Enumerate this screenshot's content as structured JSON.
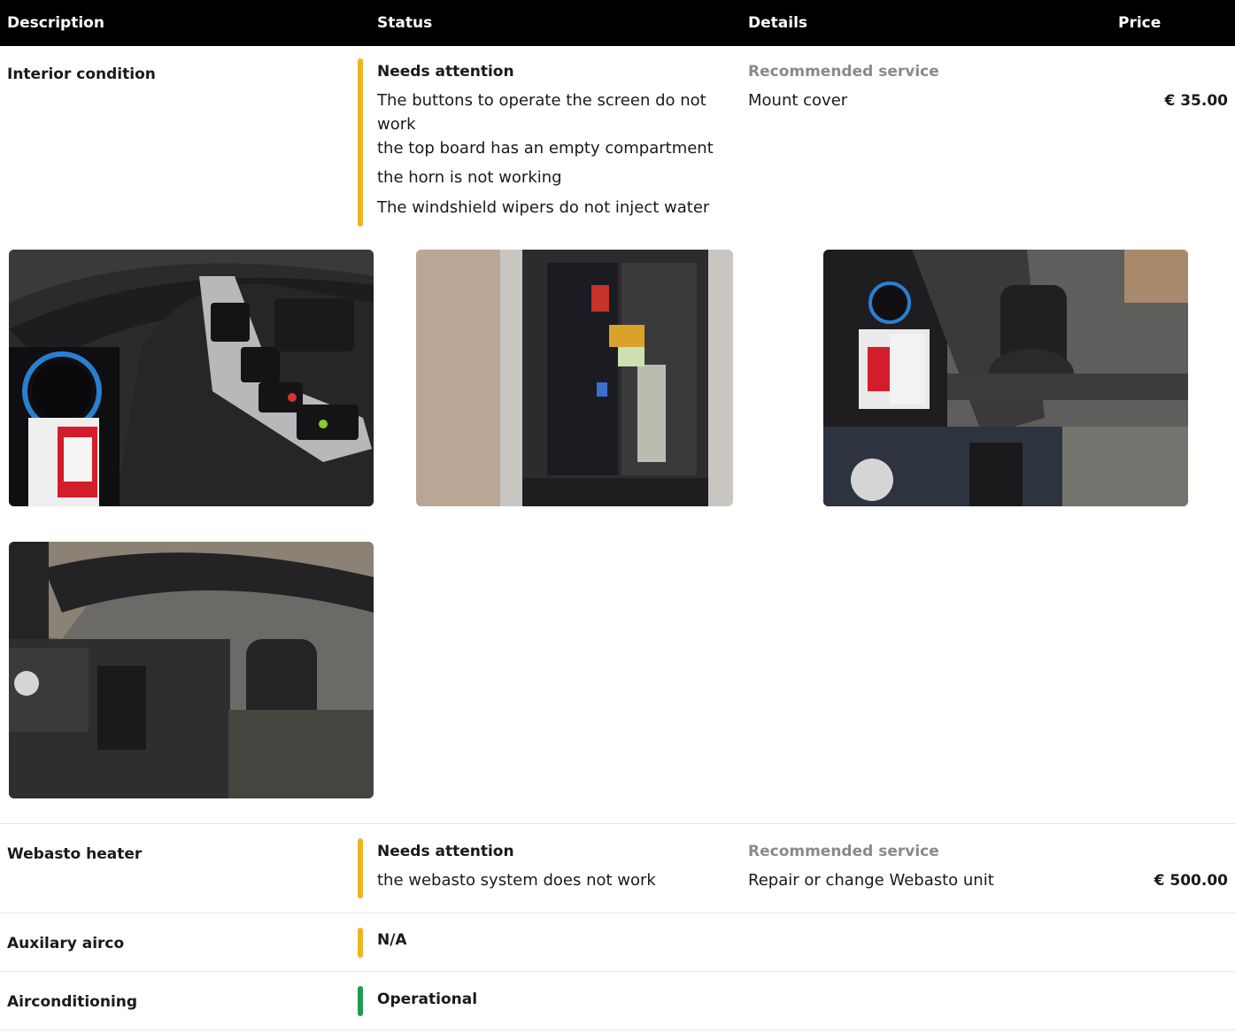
{
  "header": {
    "description": "Description",
    "status": "Status",
    "details": "Details",
    "price": "Price"
  },
  "colors": {
    "attention": "#f0b323",
    "operational": "#1f9a54",
    "header_bg": "#000000"
  },
  "rows": [
    {
      "title": "Interior condition",
      "status": "Needs attention",
      "status_color": "attention",
      "issues": [
        "The buttons to operate the screen do not work",
        "the top board has an empty compartment",
        "the horn is not working",
        "The windshield wipers do not inject water"
      ],
      "service_label": "Recommended service",
      "service": "Mount cover",
      "price": "€ 35.00",
      "photos": [
        "steering-wheel-buttons-photo",
        "radio-compartment-tachograph-photo",
        "dashboard-stalk-photo",
        "wiper-stalk-photo"
      ]
    },
    {
      "title": "Webasto heater",
      "status": "Needs attention",
      "status_color": "attention",
      "issues": [
        "the webasto system does not work"
      ],
      "service_label": "Recommended service",
      "service": "Repair or change Webasto unit",
      "price": "€ 500.00"
    },
    {
      "title": "Auxilary airco",
      "status": "N/A",
      "status_color": "attention"
    },
    {
      "title": "Airconditioning",
      "status": "Operational",
      "status_color": "operational"
    }
  ]
}
